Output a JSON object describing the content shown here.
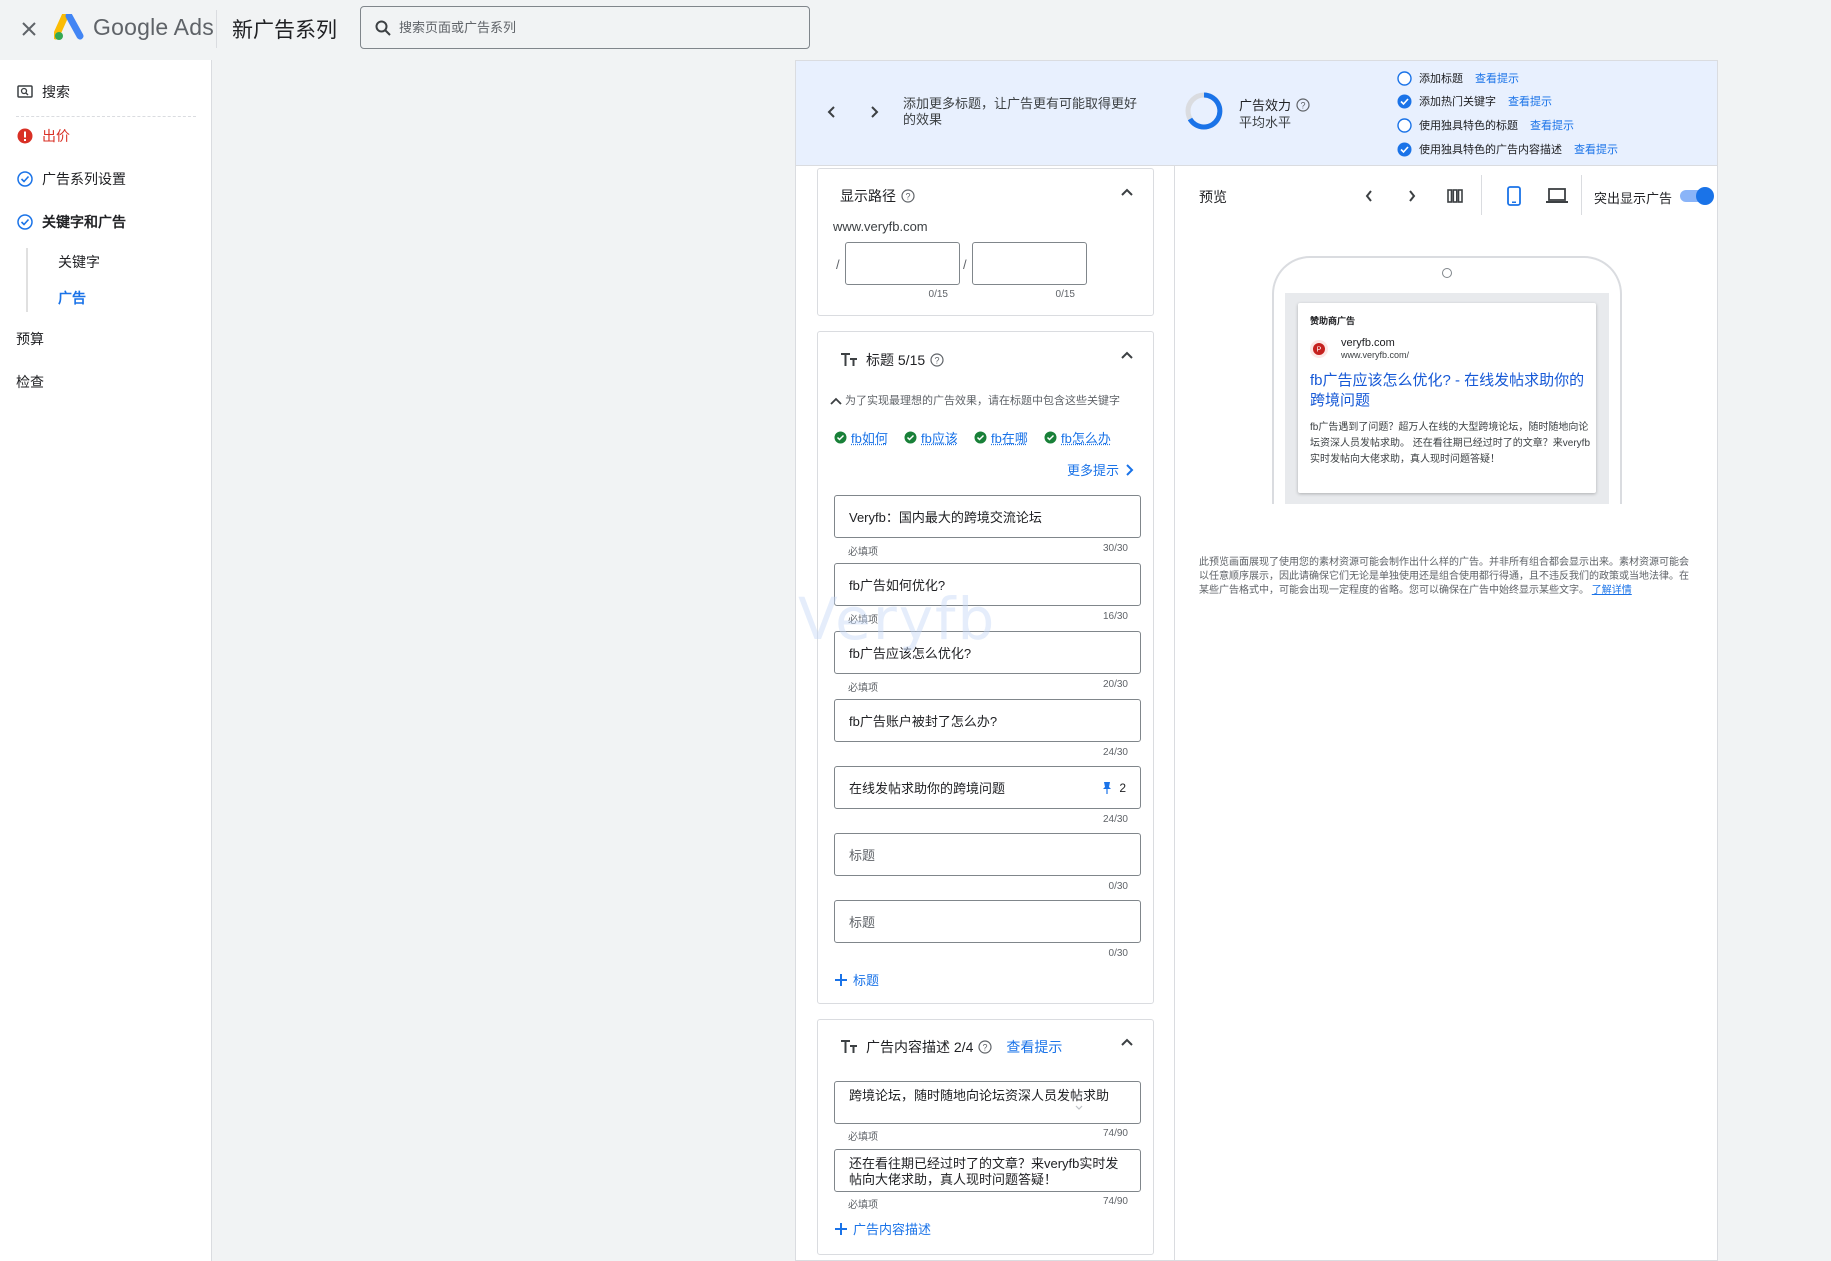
{
  "app": {
    "brand": "Google Ads",
    "page_title": "新广告系列"
  },
  "search": {
    "placeholder": "搜索页面或广告系列"
  },
  "sidebar": {
    "items": [
      {
        "label": "搜索"
      },
      {
        "label": "出价",
        "status": "error"
      },
      {
        "label": "广告系列设置",
        "status": "done"
      },
      {
        "label": "关键字和广告",
        "status": "done"
      },
      {
        "label": "关键字"
      },
      {
        "label": "广告",
        "selected": true
      },
      {
        "label": "预算"
      },
      {
        "label": "检查"
      }
    ]
  },
  "banner": {
    "message": "添加更多标题，让广告更有可能取得更好的效果",
    "strength_label": "广告效力",
    "strength_level": "平均水平",
    "checklist": [
      {
        "label": "添加标题",
        "checked": false,
        "hint": "查看提示"
      },
      {
        "label": "添加热门关键字",
        "checked": true,
        "hint": "查看提示"
      },
      {
        "label": "使用独具特色的标题",
        "checked": false,
        "hint": "查看提示"
      },
      {
        "label": "使用独具特色的广告内容描述",
        "checked": true,
        "hint": "查看提示"
      }
    ]
  },
  "display_path": {
    "title": "显示路径",
    "domain": "www.veryfb.com",
    "sep": "/",
    "path1_count": "0/15",
    "path2_count": "0/15"
  },
  "headlines": {
    "title": "标题 5/15",
    "keyword_hint": "为了实现最理想的广告效果，请在标题中包含这些关键字",
    "keywords": [
      "fb如何",
      "fb应该",
      "fb在哪",
      "fb怎么办"
    ],
    "more_hints": "更多提示",
    "required": "必填项",
    "placeholder": "标题",
    "items": [
      {
        "value": "Veryfb：国内最大的跨境交流论坛",
        "count": "30/30"
      },
      {
        "value": "fb广告如何优化?",
        "count": "16/30"
      },
      {
        "value": "fb广告应该怎么优化?",
        "count": "20/30"
      },
      {
        "value": "fb广告账户被封了怎么办?",
        "count": "24/30"
      },
      {
        "value": "在线发帖求助你的跨境问题",
        "count": "24/30",
        "pin": "2"
      },
      {
        "value": "",
        "count": "0/30"
      },
      {
        "value": "",
        "count": "0/30"
      }
    ],
    "add_label": "标题"
  },
  "descriptions": {
    "title": "广告内容描述 2/4",
    "hint": "查看提示",
    "required": "必填项",
    "items": [
      {
        "value": "跨境论坛，随时随地向论坛资深人员发帖求助",
        "count": "74/90"
      },
      {
        "value": "还在看往期已经过时了的文章？来veryfb实时发帖向大佬求助，真人现时问题答疑！",
        "count": "74/90"
      }
    ],
    "add_label": "广告内容描述"
  },
  "preview": {
    "label": "预览",
    "highlight_label": "突出显示广告",
    "highlight_on": true,
    "ad": {
      "sponsor": "赞助商广告",
      "domain": "veryfb.com",
      "url": "www.veryfb.com/",
      "headline": "fb广告应该怎么优化? - 在线发帖求助你的跨境问题",
      "description": "fb广告遇到了问题？超万人在线的大型跨境论坛，随时随地向论坛资深人员发帖求助。 还在看往期已经过时了的文章？来veryfb实时发帖向大佬求助，真人现时问题答疑！"
    },
    "note": "此预览画面展现了使用您的素材资源可能会制作出什么样的广告。并非所有组合都会显示出来。素材资源可能会以任意顺序展示，因此请确保它们无论是单独使用还是组合使用都行得通，且不违反我们的政策或当地法律。在某些广告格式中，可能会出现一定程度的省略。您可以确保在广告中始终显示某些文字。",
    "learn_more": "了解详情"
  },
  "watermark": "Veryfb",
  "colors": {
    "accent": "#1a73e8",
    "error": "#d93025",
    "success": "#188038",
    "banner_bg": "#e8f0fe"
  }
}
